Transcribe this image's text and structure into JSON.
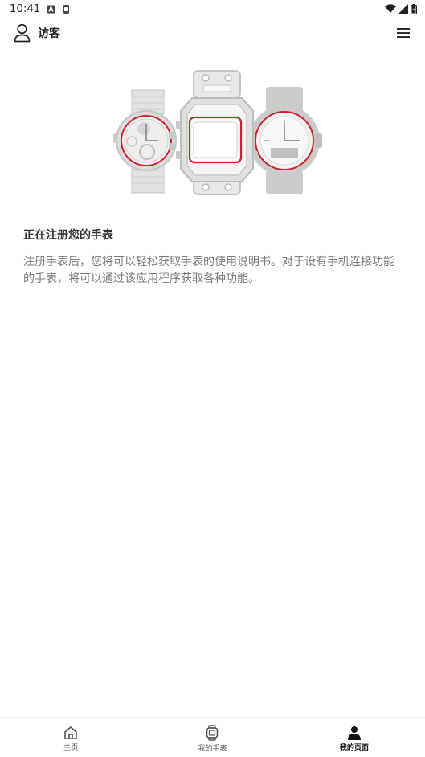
{
  "status_bar": {
    "time": "10:41",
    "left_icons": [
      "a-icon",
      "watch-notification-icon"
    ],
    "right_icons": [
      "wifi-icon",
      "signal-icon",
      "battery-icon"
    ]
  },
  "header": {
    "user_icon": "person-outline-icon",
    "user_name": "访客",
    "menu_icon": "hamburger-menu-icon"
  },
  "main": {
    "hero_icon": "three-watches-illustration",
    "title": "正在注册您的手表",
    "description": "注册手表后，您将可以轻松获取手表的使用说明书。对于设有手机连接功能的手表，将可以通过该应用程序获取各种功能。"
  },
  "tabs": [
    {
      "label": "主页",
      "icon": "home-icon",
      "active": false
    },
    {
      "label": "我的手表",
      "icon": "watch-icon",
      "active": false
    },
    {
      "label": "我的页面",
      "icon": "person-icon",
      "active": true
    }
  ],
  "colors": {
    "accent": "#d0202e",
    "text_primary": "#333333",
    "text_secondary": "#7a7a7a",
    "watch_gray": "#c9c9c9"
  }
}
